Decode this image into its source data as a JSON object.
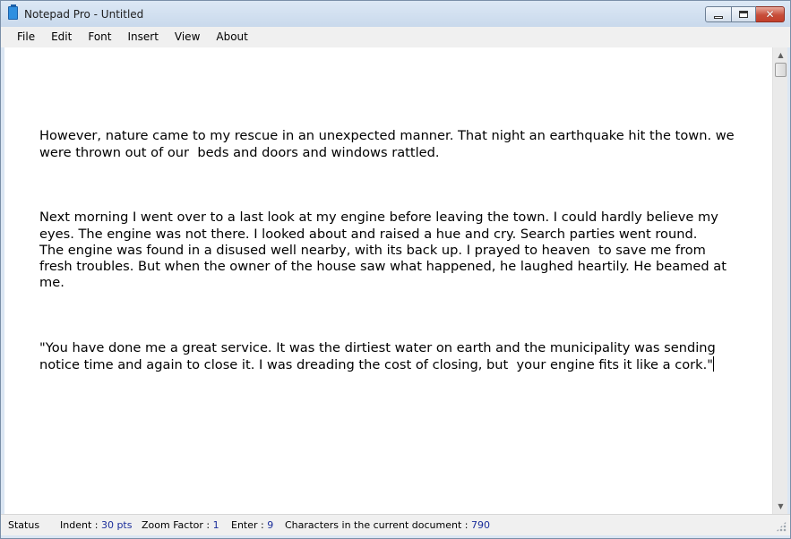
{
  "window": {
    "title": "Notepad Pro - Untitled",
    "close_glyph": "✕"
  },
  "menu": {
    "items": [
      "File",
      "Edit",
      "Font",
      "Insert",
      "View",
      "About"
    ]
  },
  "document": {
    "paragraphs": [
      "However, nature came to my rescue in an unexpected manner. That night an earthquake hit the town. we\nwere thrown out of our  beds and doors and windows rattled.",
      "Next morning I went over to a last look at my engine before leaving the town. I could hardly believe my\neyes. The engine was not there. I looked about and raised a hue and cry. Search parties went round.\nThe engine was found in a disused well nearby, with its back up. I prayed to heaven  to save me from\nfresh troubles. But when the owner of the house saw what happened, he laughed heartily. He beamed at\nme.",
      "\"You have done me a great service. It was the dirtiest water on earth and the municipality was sending\nnotice time and again to close it. I was dreading the cost of closing, but  your engine fits it like a cork.\""
    ]
  },
  "status": {
    "label": "Status",
    "indent_label": "Indent :",
    "indent_value": "30 pts",
    "zoom_label": "Zoom Factor :",
    "zoom_value": "1",
    "enter_label": "Enter :",
    "enter_value": "9",
    "chars_label": "Characters in the current document :",
    "chars_value": "790"
  },
  "colors": {
    "status_value": "#1a2d9a",
    "title_bar": "#c9d9ec"
  }
}
